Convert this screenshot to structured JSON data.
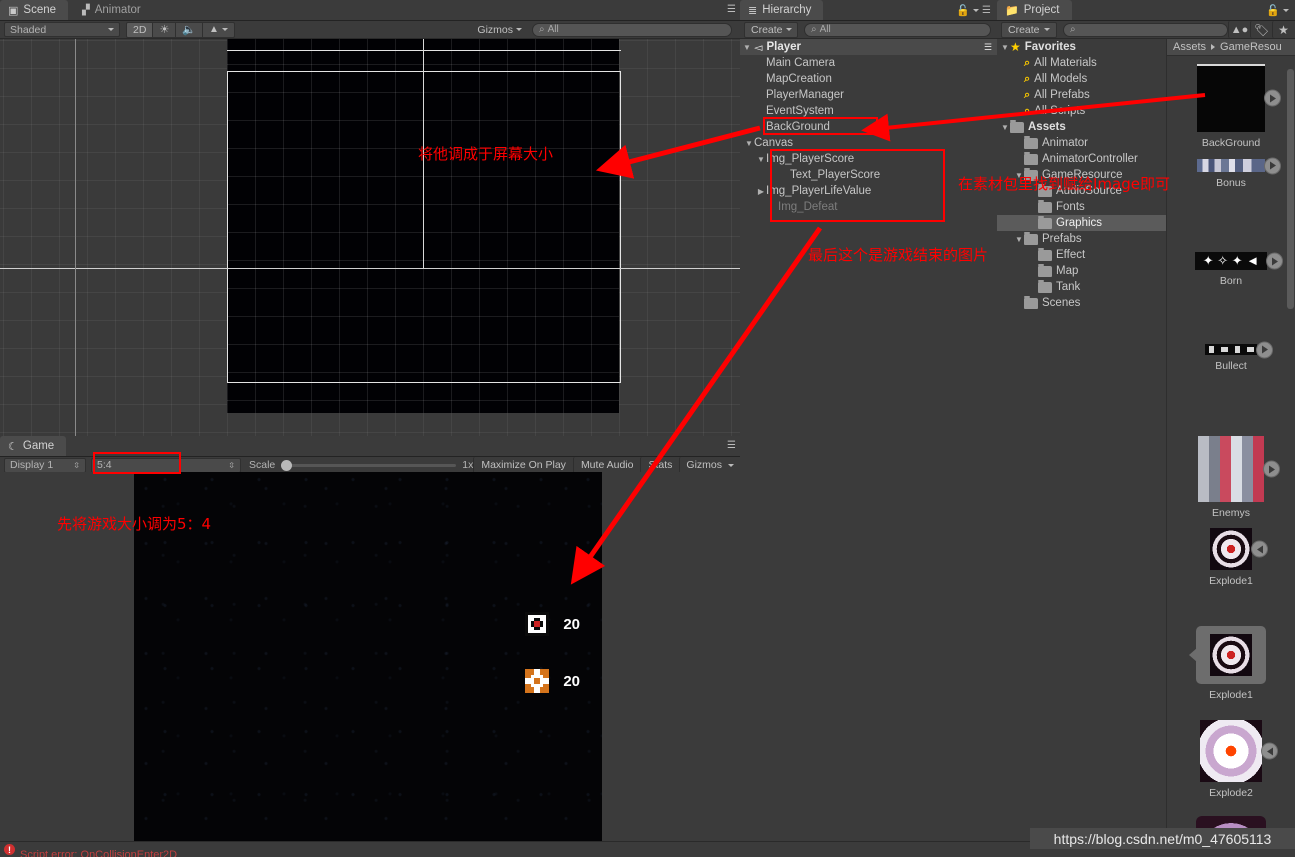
{
  "scene": {
    "tabs": [
      {
        "label": "Scene",
        "icon": "grid-icon",
        "active": true
      },
      {
        "label": "Animator",
        "icon": "animator-icon",
        "active": false
      }
    ],
    "toolbar": {
      "shading": "Shaded",
      "mode_2d": "2D",
      "light_icon": "sun-icon",
      "audio_icon": "speaker-icon",
      "fx_icon": "image-icon",
      "gizmos": "Gizmos",
      "search_placeholder": "All",
      "search_value": ""
    }
  },
  "game": {
    "tab": {
      "label": "Game",
      "icon": "gamepad-icon"
    },
    "toolbar": {
      "display": "Display 1",
      "aspect": "5:4",
      "scale_label": "Scale",
      "scale_value": "1x",
      "maximize": "Maximize On Play",
      "mute": "Mute Audio",
      "stats": "Stats",
      "gizmos": "Gizmos"
    },
    "hud": [
      {
        "icon": "white-tank-icon",
        "value": "20"
      },
      {
        "icon": "orange-tank-icon",
        "value": "20"
      }
    ]
  },
  "hierarchy": {
    "tab": {
      "label": "Hierarchy",
      "icon": "list-icon"
    },
    "toolbar": {
      "create": "Create",
      "search_placeholder": "All",
      "search_value": ""
    },
    "root": {
      "label": "Player",
      "icon": "unity-scene-icon"
    },
    "items": [
      {
        "label": "Main Camera",
        "indent": 1,
        "arrow": "",
        "dim": false
      },
      {
        "label": "MapCreation",
        "indent": 1,
        "arrow": "",
        "dim": false
      },
      {
        "label": "PlayerManager",
        "indent": 1,
        "arrow": "",
        "dim": false
      },
      {
        "label": "EventSystem",
        "indent": 1,
        "arrow": "",
        "dim": false
      },
      {
        "label": "BackGround",
        "indent": 1,
        "arrow": "",
        "dim": false
      },
      {
        "label": "Canvas",
        "indent": 0,
        "arrow": "▼",
        "dim": false
      },
      {
        "label": "Img_PlayerScore",
        "indent": 1,
        "arrow": "▼",
        "dim": false
      },
      {
        "label": "Text_PlayerScore",
        "indent": 3,
        "arrow": "",
        "dim": false
      },
      {
        "label": "Img_PlayerLifeValue",
        "indent": 1,
        "arrow": "▶",
        "dim": false
      },
      {
        "label": "Img_Defeat",
        "indent": 2,
        "arrow": "",
        "dim": true
      }
    ]
  },
  "project": {
    "tab": {
      "label": "Project",
      "icon": "folder-icon"
    },
    "toolbar": {
      "create": "Create",
      "search_placeholder": "",
      "search_value": "",
      "filter_type_icon": "shapes-icon",
      "filter_label_icon": "tag-icon",
      "favorite_icon": "star-icon"
    },
    "breadcrumb": [
      "Assets",
      "GameResou"
    ],
    "tree": [
      {
        "label": "Favorites",
        "indent": 0,
        "arrow": "▼",
        "icon": "star-icon",
        "bold": true
      },
      {
        "label": "All Materials",
        "indent": 1,
        "arrow": "",
        "icon": "search-icon",
        "bold": false
      },
      {
        "label": "All Models",
        "indent": 1,
        "arrow": "",
        "icon": "search-icon",
        "bold": false
      },
      {
        "label": "All Prefabs",
        "indent": 1,
        "arrow": "",
        "icon": "search-icon",
        "bold": false
      },
      {
        "label": "All Scripts",
        "indent": 1,
        "arrow": "",
        "icon": "search-icon",
        "bold": false
      },
      {
        "label": "Assets",
        "indent": 0,
        "arrow": "▼",
        "icon": "folder-icon",
        "bold": true
      },
      {
        "label": "Animator",
        "indent": 1,
        "arrow": "",
        "icon": "folder-icon",
        "bold": false
      },
      {
        "label": "AnimatorController",
        "indent": 1,
        "arrow": "",
        "icon": "folder-icon",
        "bold": false
      },
      {
        "label": "GameResource",
        "indent": 1,
        "arrow": "▼",
        "icon": "folder-icon",
        "bold": false
      },
      {
        "label": "AudioSource",
        "indent": 2,
        "arrow": "",
        "icon": "folder-icon",
        "bold": false
      },
      {
        "label": "Fonts",
        "indent": 2,
        "arrow": "",
        "icon": "folder-icon",
        "bold": false
      },
      {
        "label": "Graphics",
        "indent": 2,
        "arrow": "",
        "icon": "folder-icon",
        "bold": false,
        "selected": true
      },
      {
        "label": "Prefabs",
        "indent": 1,
        "arrow": "▼",
        "icon": "folder-icon",
        "bold": false
      },
      {
        "label": "Effect",
        "indent": 2,
        "arrow": "",
        "icon": "folder-icon",
        "bold": false
      },
      {
        "label": "Map",
        "indent": 2,
        "arrow": "",
        "icon": "folder-icon",
        "bold": false
      },
      {
        "label": "Tank",
        "indent": 2,
        "arrow": "",
        "icon": "folder-icon",
        "bold": false
      },
      {
        "label": "Scenes",
        "indent": 1,
        "arrow": "",
        "icon": "folder-icon",
        "bold": false
      }
    ],
    "assets": [
      {
        "name": "BackGround",
        "kind": "black-square",
        "selected": false,
        "badge": "right"
      },
      {
        "name": "Bonus",
        "kind": "bonus-strip",
        "selected": false,
        "badge": "right"
      },
      {
        "name": "Born",
        "kind": "born-sprites",
        "selected": false,
        "badge": "right"
      },
      {
        "name": "Bullect",
        "kind": "bullet-sprites",
        "selected": false,
        "badge": "right"
      },
      {
        "name": "Enemys",
        "kind": "enemy-sheet",
        "selected": false,
        "badge": "right"
      },
      {
        "name": "Explode1",
        "kind": "explode-small",
        "selected": false,
        "badge": "left"
      },
      {
        "name": "Explode1",
        "kind": "explode-small",
        "selected": true,
        "badge": "none"
      },
      {
        "name": "Explode2",
        "kind": "explode-big",
        "selected": false,
        "badge": "left"
      },
      {
        "name": "",
        "kind": "explode-partial",
        "selected": false,
        "badge": "none"
      }
    ]
  },
  "annotations": [
    {
      "id": "scene-note",
      "text": "将他调成于屏幕大小"
    },
    {
      "id": "project-note",
      "text": "在素材包里找到赋给Image即可"
    },
    {
      "id": "defeat-note",
      "text": "最后这个是游戏结束的图片"
    },
    {
      "id": "game-note",
      "text": "先将游戏大小调为5：4"
    }
  ],
  "statusbar": {
    "message": "Script error: OnCollisionEnter2D",
    "error_icon": "error-icon"
  },
  "watermark": {
    "url": "https://blog.csdn.net/m0_47605113"
  },
  "colors": {
    "accent_red": "#ff0000",
    "panel_bg": "#3b3b3b",
    "selection": "#5b5b5b"
  }
}
